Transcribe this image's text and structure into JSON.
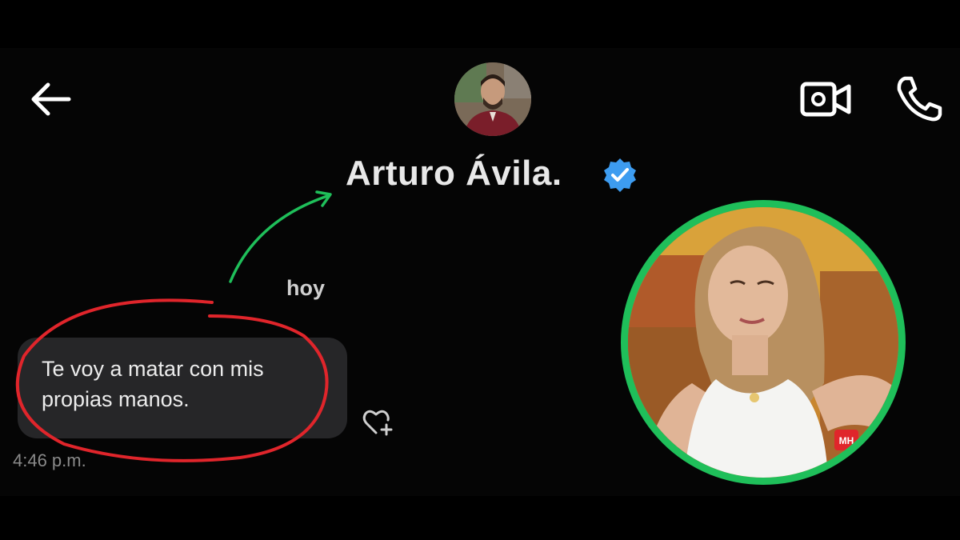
{
  "header": {
    "contact_name": "Arturo Ávila.",
    "back_icon": "arrow-left-icon",
    "verified_icon": "verified-badge-icon",
    "video_icon": "video-camera-icon",
    "call_icon": "phone-icon"
  },
  "chat": {
    "day_label": "hoy",
    "messages": [
      {
        "text": "Te voy a matar con mis propias manos.",
        "time": "4:46 p.m."
      }
    ],
    "reaction_icon": "heart-add-icon"
  },
  "photo_overlay": {
    "watermark": "MH"
  },
  "colors": {
    "background": "#000000",
    "bubble": "#262628",
    "verified": "#3d9cf0",
    "annotation_red": "#e0252b",
    "annotation_green": "#1fbf5a"
  }
}
